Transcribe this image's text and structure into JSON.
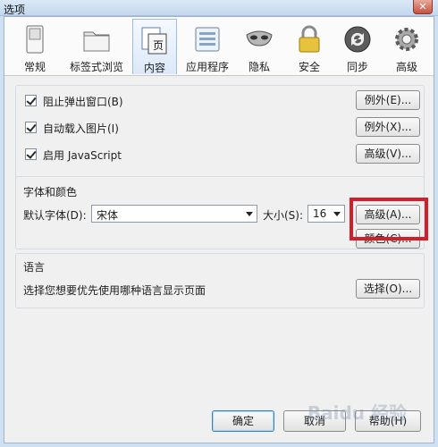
{
  "window": {
    "title": "选项",
    "close_label": "✕"
  },
  "toolbar": {
    "tabs": [
      {
        "label": "常规",
        "icon": "switch-icon"
      },
      {
        "label": "标签式浏览",
        "icon": "folder-tabs-icon"
      },
      {
        "label": "内容",
        "icon": "content-page-icon",
        "selected": true
      },
      {
        "label": "应用程序",
        "icon": "applications-icon"
      },
      {
        "label": "隐私",
        "icon": "mask-icon"
      },
      {
        "label": "安全",
        "icon": "padlock-icon"
      },
      {
        "label": "同步",
        "icon": "sync-icon"
      },
      {
        "label": "高级",
        "icon": "gear-icon"
      }
    ]
  },
  "content": {
    "block_popups": {
      "label": "阻止弹出窗口(B)",
      "checked": true,
      "button": "例外(E)..."
    },
    "load_images": {
      "label": "自动载入图片(I)",
      "checked": true,
      "button": "例外(X)..."
    },
    "enable_js": {
      "label": "启用 JavaScript",
      "checked": true,
      "button": "高级(V)..."
    }
  },
  "fonts": {
    "title": "字体和颜色",
    "default_font_label": "默认字体(D):",
    "default_font_value": "宋体",
    "size_label": "大小(S):",
    "size_value": "16",
    "advanced_button": "高级(A)...",
    "colors_button": "颜色(C)..."
  },
  "language": {
    "title": "语言",
    "description": "选择您想要优先使用哪种语言显示页面",
    "choose_button": "选择(O)..."
  },
  "footer": {
    "ok": "确定",
    "cancel": "取消",
    "help": "帮助(H)"
  },
  "watermark": "Baidu 经验",
  "colors": {
    "highlight": "#d11f2c",
    "selected_tab": "#dbe8f8"
  }
}
